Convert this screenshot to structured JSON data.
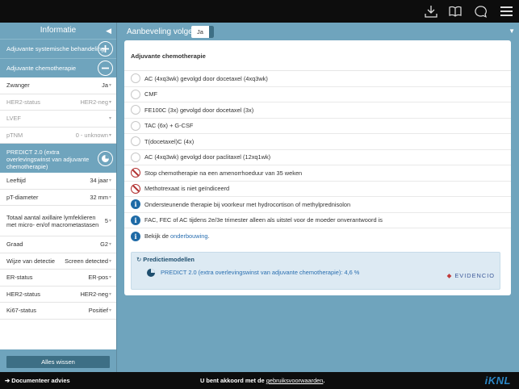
{
  "sidebar": {
    "title": "Informatie",
    "sections": {
      "systemic": "Adjuvante systemische behandeling",
      "chemo": "Adjuvante chemotherapie"
    },
    "fields_top": [
      {
        "label": "Zwanger",
        "value": "Ja",
        "disabled": false
      },
      {
        "label": "HER2-status",
        "value": "HER2-neg",
        "disabled": true
      },
      {
        "label": "LVEF",
        "value": "",
        "disabled": true
      },
      {
        "label": "pTNM",
        "value": "0 - unknown",
        "disabled": true
      }
    ],
    "predict_section": "PREDICT 2.0 (extra overlevingswinst van adjuvante chemotherapie)",
    "fields_predict": [
      {
        "label": "Leeftijd",
        "value": "34 jaar"
      },
      {
        "label": "pT-diameter",
        "value": "32 mm"
      },
      {
        "label": "Totaal aantal axillaire lymfeklieren met micro- en/of macrometastasen",
        "value": "5"
      },
      {
        "label": "Graad",
        "value": "G2"
      },
      {
        "label": "Wijze van detectie",
        "value": "Screen detected"
      },
      {
        "label": "ER-status",
        "value": "ER-pos"
      },
      {
        "label": "HER2-status",
        "value": "HER2-neg"
      },
      {
        "label": "Ki67-status",
        "value": "Positief"
      }
    ],
    "clear_button": "Alles wissen"
  },
  "main": {
    "recommendation_label": "Aanbeveling volgen",
    "recommendation_value": "Ja",
    "card_title": "Adjuvante chemotherapie",
    "options": [
      {
        "type": "radio",
        "text": "AC (4xq3wk) gevolgd door docetaxel (4xq3wk)"
      },
      {
        "type": "radio",
        "text": "CMF"
      },
      {
        "type": "radio",
        "text": "FE100C (3x) gevolgd door docetaxel (3x)"
      },
      {
        "type": "radio",
        "text": "TAC (6x) + G-CSF"
      },
      {
        "type": "radio",
        "text": "T(docetaxel)C (4x)"
      },
      {
        "type": "radio",
        "text": "AC (4xq3wk) gevolgd door paclitaxel (12xq1wk)"
      },
      {
        "type": "stop",
        "text": "Stop chemotherapie na een amenorrhoeduur van 35 weken"
      },
      {
        "type": "stop",
        "text": "Methotrexaat is niet geïndiceerd"
      },
      {
        "type": "info",
        "text": "Ondersteunende therapie bij voorkeur met hydrocortison of methylprednisolon"
      },
      {
        "type": "info",
        "text": "FAC, FEC of AC tijdens 2e/3e trimester alleen als uitstel voor de moeder onverantwoord is"
      }
    ],
    "info_link_prefix": "Bekijk de ",
    "info_link_text": "onderbouwing",
    "info_link_suffix": ".",
    "prediction": {
      "title": "Predictiemodellen",
      "item": "PREDICT 2.0 (extra overlevingswinst van adjuvante chemotherapie): 4,6 %",
      "brand": "EVIDENCIO"
    }
  },
  "footer": {
    "documenteer": "Documenteer advies",
    "agree_prefix": "U bent akkoord met de ",
    "agree_link": "gebruiksvoorwaarden",
    "agree_suffix": ".",
    "logo": "iKNL"
  },
  "colors": {
    "accent": "#6fa4bd",
    "dark": "#3d6f85",
    "stop": "#b23030",
    "info": "#1e6aa6"
  }
}
